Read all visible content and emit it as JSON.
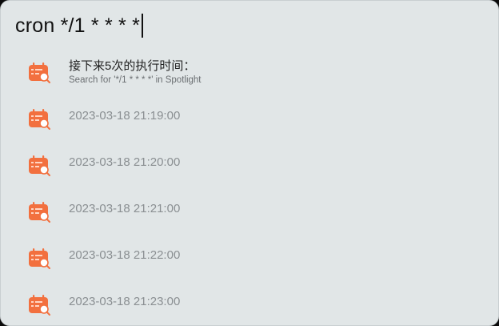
{
  "search": {
    "query": "cron */1 * * * *"
  },
  "results": [
    {
      "icon": "calendar-search-icon",
      "title": "接下来5次的执行时间：",
      "subtitle": "Search for '*/1 * * * *' in Spotlight"
    },
    {
      "icon": "calendar-search-icon",
      "time": "2023-03-18 21:19:00"
    },
    {
      "icon": "calendar-search-icon",
      "time": "2023-03-18 21:20:00"
    },
    {
      "icon": "calendar-search-icon",
      "time": "2023-03-18 21:21:00"
    },
    {
      "icon": "calendar-search-icon",
      "time": "2023-03-18 21:22:00"
    },
    {
      "icon": "calendar-search-icon",
      "time": "2023-03-18 21:23:00"
    }
  ],
  "colors": {
    "background": "#e1e6e7",
    "icon_accent": "#f2703f",
    "text_primary": "#222222",
    "text_secondary": "#8a8f92"
  }
}
